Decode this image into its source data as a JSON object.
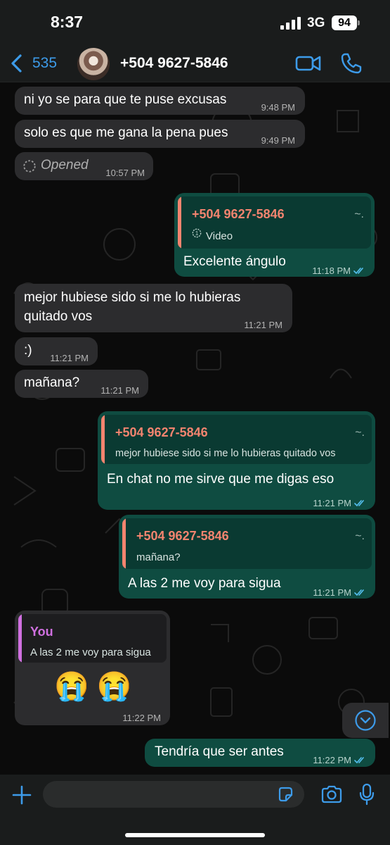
{
  "status_bar": {
    "time": "8:37",
    "network": "3G",
    "battery": "94"
  },
  "header": {
    "back_count": "535",
    "contact_name": "+504 9627-5846"
  },
  "messages": [
    {
      "dir": "in",
      "text": "ni yo se para que te puse excusas",
      "time": "9:48 PM"
    },
    {
      "dir": "in",
      "text": "solo es que me gana la pena pues",
      "time": "9:49 PM"
    },
    {
      "dir": "in",
      "text": "Opened",
      "time": "10:57 PM"
    },
    {
      "dir": "out",
      "reply_name": "+504 9627-5846",
      "reply_dots": "~.",
      "reply_text": "Video",
      "text": "Excelente ángulo",
      "time": "11:18 PM"
    },
    {
      "dir": "in",
      "text_line1": "mejor hubiese sido si me lo hubieras",
      "text_line2": "quitado vos",
      "time": "11:21 PM"
    },
    {
      "dir": "in",
      "text": ":)",
      "time": "11:21 PM"
    },
    {
      "dir": "in",
      "text": "mañana?",
      "time": "11:21 PM"
    },
    {
      "dir": "out",
      "reply_name": "+504 9627-5846",
      "reply_dots": "~.",
      "reply_text": "mejor hubiese sido si me lo hubieras quitado vos",
      "text": "En chat no me sirve que me digas eso",
      "time": "11:21 PM"
    },
    {
      "dir": "out",
      "reply_name": "+504 9627-5846",
      "reply_dots": "~.",
      "reply_text": "mañana?",
      "text": "A las 2 me voy para sigua",
      "time": "11:21 PM"
    },
    {
      "dir": "in",
      "reply_name": "You",
      "reply_text": "A las 2 me voy para sigua",
      "text": "😭 😭",
      "time": "11:22 PM"
    },
    {
      "dir": "out",
      "text": "Tendría que ser antes",
      "time": "11:22 PM"
    }
  ],
  "colors": {
    "accent_blue": "#3d9be9",
    "outgoing_bubble": "#0f4c41",
    "incoming_bubble": "#2c2c2e",
    "reply_name_other": "#f4846f",
    "reply_name_you": "#d070e0",
    "read_ticks": "#53bdeb"
  },
  "icons": {
    "back": "chevron-left-icon",
    "video": "video-camera-icon",
    "call": "phone-icon",
    "opened": "dashed-circle-icon",
    "view_once": "view-once-icon",
    "plus": "plus-icon",
    "sticker": "sticker-icon",
    "camera": "camera-icon",
    "mic": "microphone-icon",
    "scroll": "chevron-down-circle-icon"
  }
}
